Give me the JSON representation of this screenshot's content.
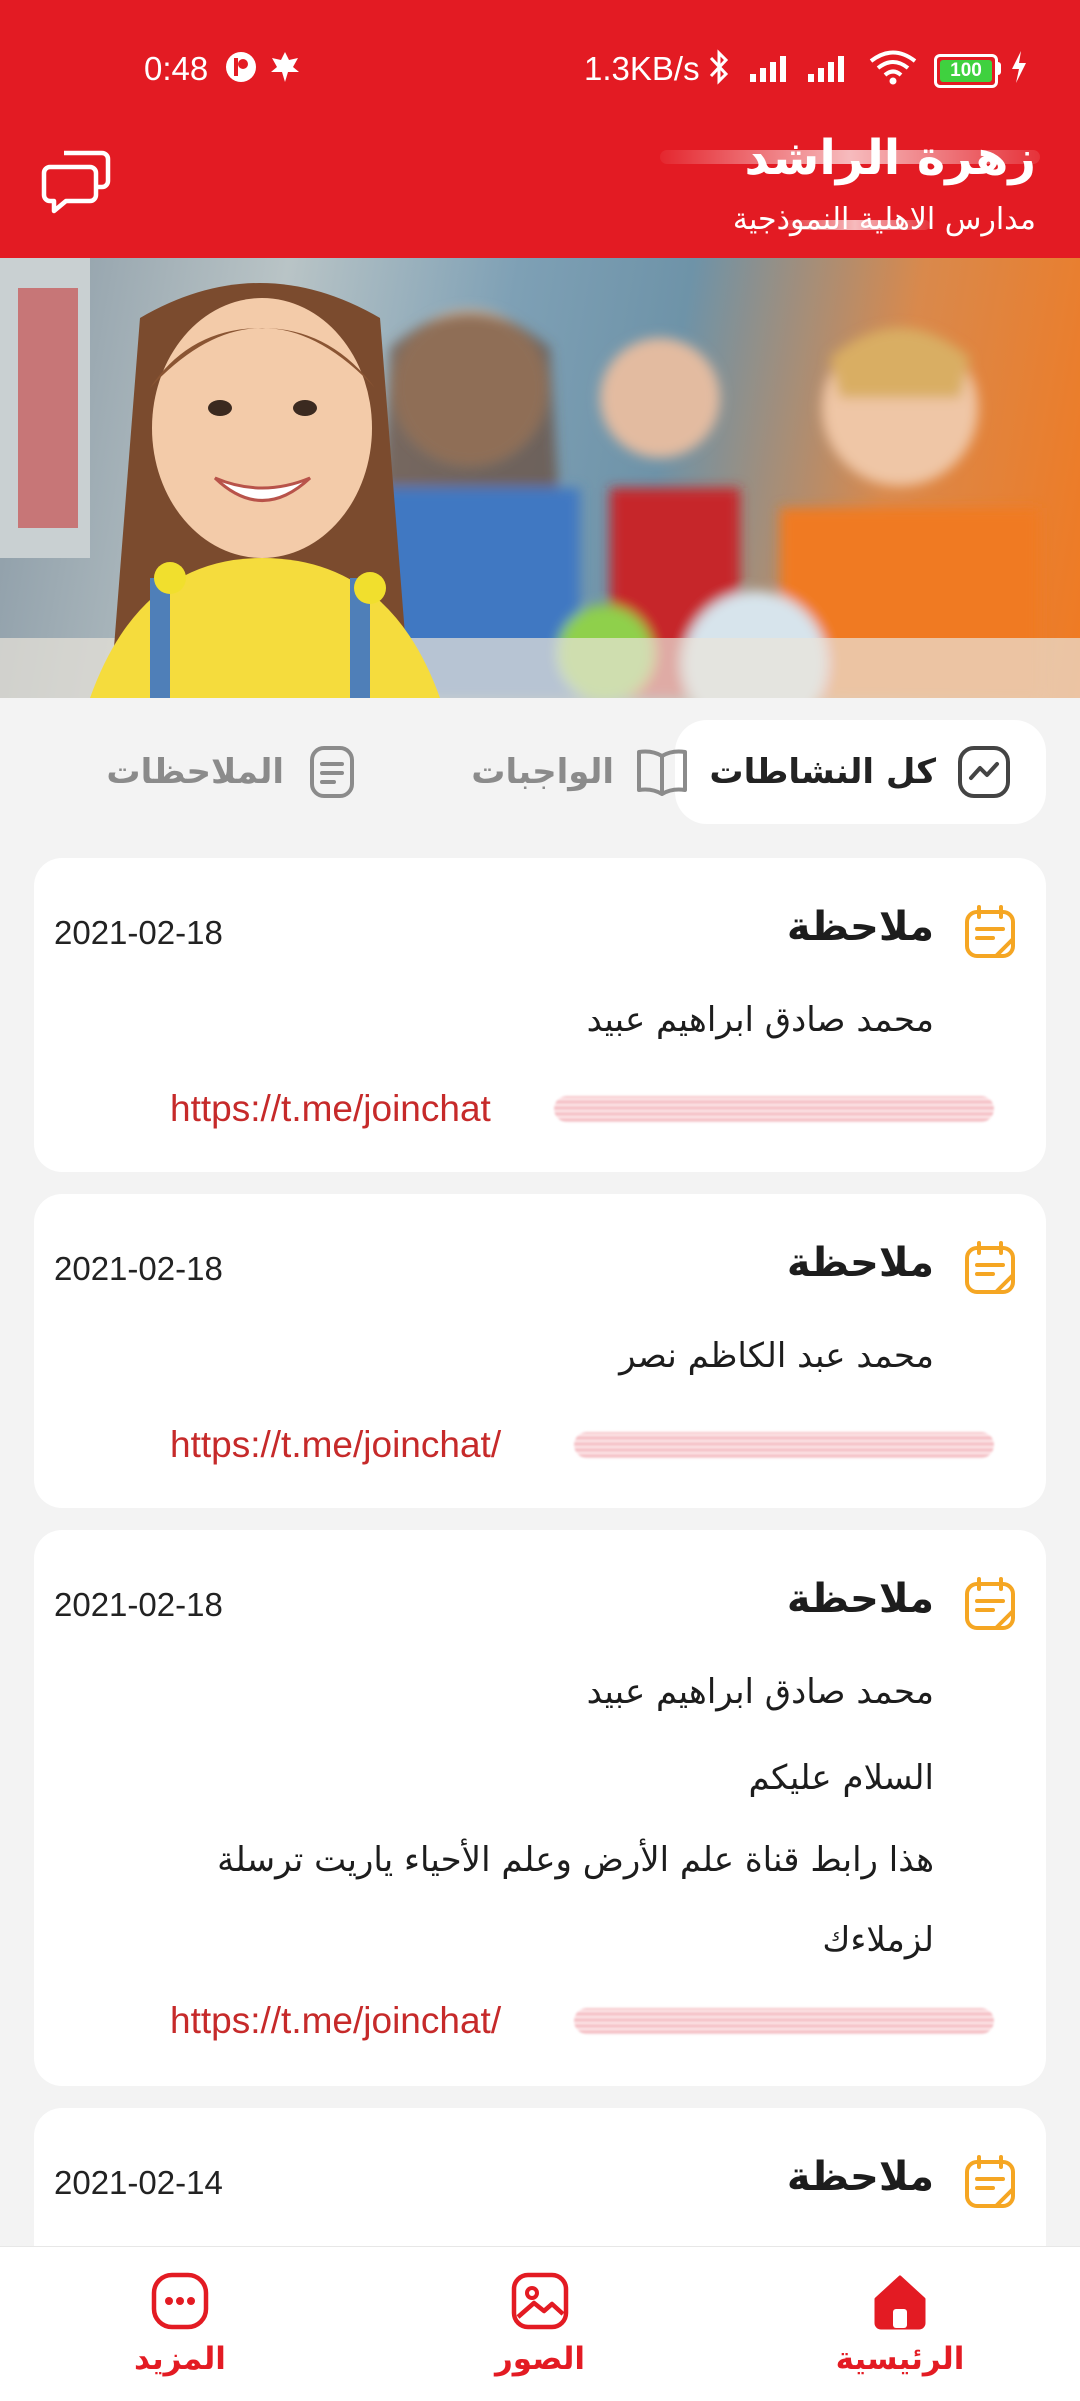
{
  "status_bar": {
    "time": "0:48",
    "net_speed": "1.3KB/s",
    "battery": "100"
  },
  "header": {
    "title": "زهرة الراشد",
    "subtitle": "مدارس الاهلية النموذجية"
  },
  "tabs": [
    {
      "label": "كل النشاطات",
      "icon": "activity-chart-icon",
      "active": true
    },
    {
      "label": "الواجبات",
      "icon": "open-book-icon",
      "active": false
    },
    {
      "label": "الملاحظات",
      "icon": "notes-doc-icon",
      "active": false
    }
  ],
  "cards": [
    {
      "title": "ملاحظة",
      "date": "2021-02-18",
      "lines": [
        "محمد صادق ابراهيم عبيد"
      ],
      "link": "https://t.me/joinchat"
    },
    {
      "title": "ملاحظة",
      "date": "2021-02-18",
      "lines": [
        "محمد عبد الكاظم نصر"
      ],
      "link": "https://t.me/joinchat/"
    },
    {
      "title": "ملاحظة",
      "date": "2021-02-18",
      "lines": [
        "محمد صادق ابراهيم عبيد",
        "السلام عليكم",
        "هذا رابط قناة علم الأرض وعلم الأحياء ياريت ترسلة",
        "لزملاءك"
      ],
      "link": "https://t.me/joinchat/"
    },
    {
      "title": "ملاحظة",
      "date": "2021-02-14",
      "lines": [],
      "link": ""
    }
  ],
  "bottom_nav": [
    {
      "label": "المزيد",
      "icon": "more-dots-icon"
    },
    {
      "label": "الصور",
      "icon": "image-icon"
    },
    {
      "label": "الرئيسية",
      "icon": "home-icon"
    }
  ],
  "colors": {
    "brand_red": "#e31b23",
    "note_icon_orange": "#f5a623",
    "link_red": "#c62a2a"
  }
}
